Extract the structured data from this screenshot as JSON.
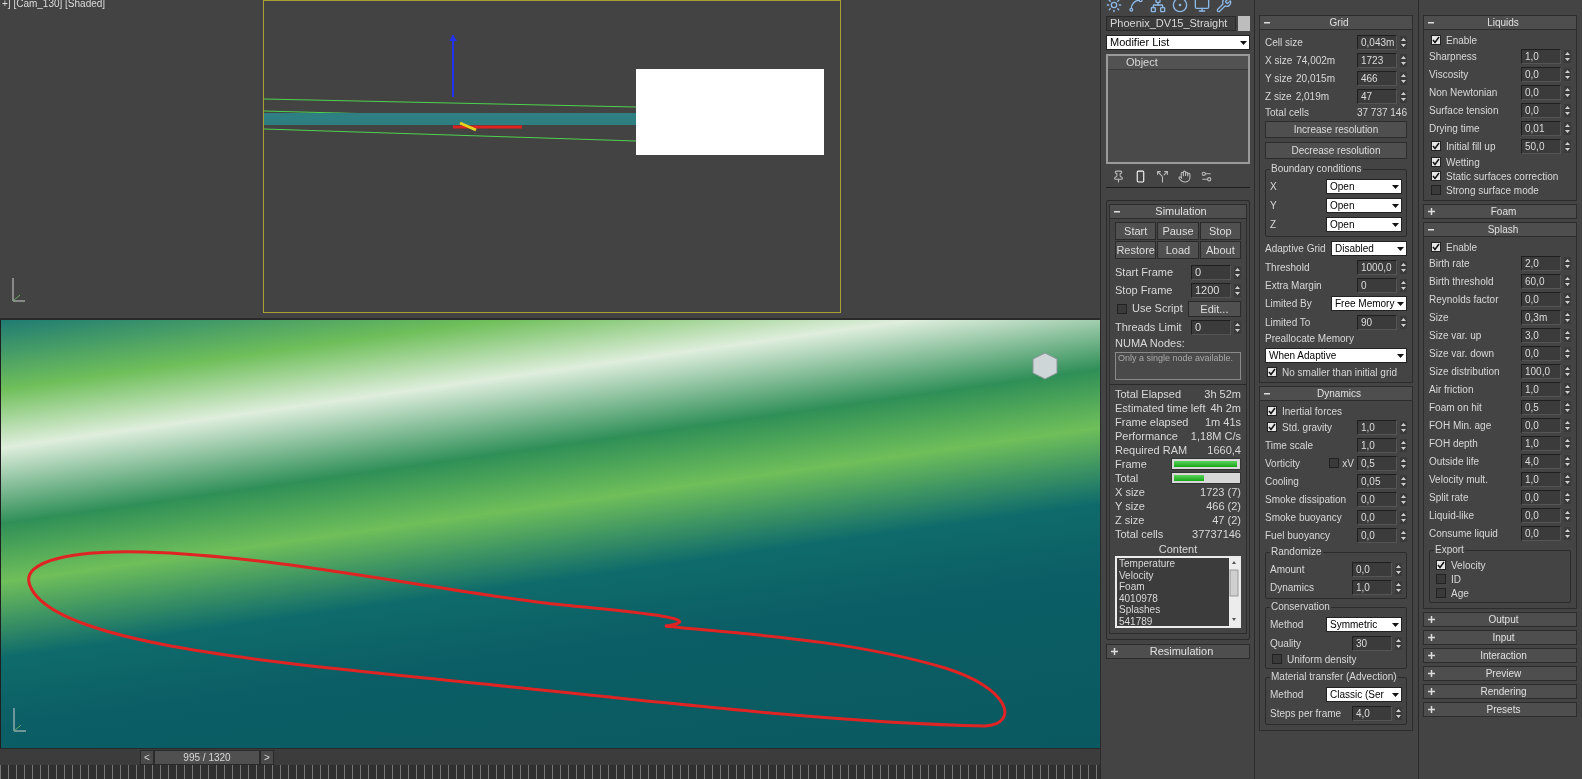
{
  "viewport": {
    "label": "+] [Cam_130] [Shaded]",
    "time_slider": {
      "prev": "<",
      "position": "995 / 1320",
      "next": ">"
    }
  },
  "modify_panel": {
    "object_name": "Phoenix_DV15_Straight",
    "modifier_list": "Modifier List",
    "stack_header": "Object",
    "rollouts": [
      {
        "title": "Simulation",
        "expanded": true,
        "rows": [
          {
            "kind": "button_grid",
            "buttons": [
              "Start",
              "Pause",
              "Stop",
              "Restore",
              "Load",
              "About"
            ]
          },
          {
            "kind": "spinner",
            "label": "Start Frame",
            "value": "0"
          },
          {
            "kind": "spinner",
            "label": "Stop Frame",
            "value": "1200"
          },
          {
            "kind": "check_button",
            "label": "Use Script",
            "checked": false,
            "button": "Edit..."
          },
          {
            "kind": "spinner",
            "label": "Threads Limit",
            "value": "0"
          },
          {
            "kind": "textarea",
            "label": "NUMA Nodes:",
            "placeholder": "Only a single node available."
          },
          {
            "kind": "stats",
            "rows": [
              {
                "kind": "stat",
                "label": "Total Elapsed",
                "value": "3h 52m"
              },
              {
                "kind": "stat",
                "label": "Estimated time left",
                "value": "4h 2m"
              },
              {
                "kind": "stat",
                "label": "Frame elapsed",
                "value": "1m 41s"
              },
              {
                "kind": "stat",
                "label": "Performance",
                "value": "1,18M C/s"
              },
              {
                "kind": "stat",
                "label": "Required RAM",
                "value": "1660,4"
              },
              {
                "kind": "progress",
                "label": "Frame",
                "level": 0.99
              },
              {
                "kind": "progress",
                "label": "Total",
                "level": 0.47
              },
              {
                "kind": "stat",
                "label": "X size",
                "value": "1723 (7)"
              },
              {
                "kind": "stat",
                "label": "Y size",
                "value": "466 (2)"
              },
              {
                "kind": "stat",
                "label": "Z size",
                "value": "47 (2)"
              },
              {
                "kind": "stat",
                "label": "Total cells",
                "value": "37737146"
              },
              {
                "kind": "list",
                "title": "Content",
                "lines": [
                  "Temperature",
                  "Velocity",
                  "Foam",
                  "4010978",
                  "Splashes",
                  "541789"
                ]
              }
            ]
          }
        ]
      },
      {
        "title": "Resimulation",
        "expanded": false
      }
    ]
  },
  "grid_panel": {
    "rollouts": [
      {
        "title": "Grid",
        "expanded": true,
        "rows": [
          {
            "kind": "spinner",
            "label": "Cell size",
            "value": "0,043m"
          },
          {
            "kind": "spinner",
            "label": "X size",
            "measure": "74,002m",
            "value": "1723"
          },
          {
            "kind": "spinner",
            "label": "Y size",
            "measure": "20,015m",
            "value": "466"
          },
          {
            "kind": "spinner",
            "label": "Z size",
            "measure": "2,019m",
            "value": "47"
          },
          {
            "kind": "stat",
            "label": "Total cells",
            "value": "37 737 146"
          },
          {
            "kind": "button",
            "label": "Increase resolution"
          },
          {
            "kind": "button",
            "label": "Decrease resolution"
          },
          {
            "kind": "group",
            "title": "Boundary conditions",
            "rows": [
              {
                "kind": "dropdown",
                "label": "X",
                "value": "Open"
              },
              {
                "kind": "dropdown",
                "label": "Y",
                "value": "Open"
              },
              {
                "kind": "dropdown",
                "label": "Z",
                "value": "Open"
              }
            ]
          },
          {
            "kind": "dropdown",
            "label": "Adaptive Grid",
            "value": "Disabled"
          },
          {
            "kind": "spinner",
            "label": "Threshold",
            "value": "1000,0"
          },
          {
            "kind": "spinner",
            "label": "Extra Margin",
            "value": "0"
          },
          {
            "kind": "dropdown",
            "label": "Limited By",
            "value": "Free Memory"
          },
          {
            "kind": "spinner",
            "label": "Limited To",
            "value": "90"
          },
          {
            "kind": "heading",
            "label": "Preallocate Memory"
          },
          {
            "kind": "dropdown",
            "value": "When Adaptive"
          },
          {
            "kind": "check",
            "label": "No smaller than initial grid",
            "checked": true
          }
        ]
      },
      {
        "title": "Dynamics",
        "expanded": true,
        "rows": [
          {
            "kind": "check",
            "label": "Inertial forces",
            "checked": true
          },
          {
            "kind": "check_spinner",
            "label": "Std. gravity",
            "checked": true,
            "value": "1,0"
          },
          {
            "kind": "spinner",
            "label": "Time scale",
            "value": "1,0"
          },
          {
            "kind": "check_inline_spinner",
            "label": "Vorticity",
            "checked": false,
            "check_label": "xV",
            "value": "0,5"
          },
          {
            "kind": "spinner",
            "label": "Cooling",
            "value": "0,05"
          },
          {
            "kind": "spinner",
            "label": "Smoke dissipation",
            "value": "0,0"
          },
          {
            "kind": "spinner",
            "label": "Smoke buoyancy",
            "value": "0,0"
          },
          {
            "kind": "spinner",
            "label": "Fuel buoyancy",
            "value": "0,0"
          },
          {
            "kind": "group",
            "title": "Randomize",
            "rows": [
              {
                "kind": "spinner",
                "label": "Amount",
                "value": "0,0"
              },
              {
                "kind": "spinner",
                "label": "Dynamics",
                "value": "1,0"
              }
            ]
          },
          {
            "kind": "group",
            "title": "Conservation",
            "rows": [
              {
                "kind": "dropdown",
                "label": "Method",
                "value": "Symmetric"
              },
              {
                "kind": "spinner",
                "label": "Quality",
                "value": "30"
              },
              {
                "kind": "check",
                "label": "Uniform density",
                "checked": false
              }
            ]
          },
          {
            "kind": "group",
            "title": "Material transfer (Advection)",
            "rows": [
              {
                "kind": "dropdown",
                "label": "Method",
                "value": "Classic (Ser"
              },
              {
                "kind": "spinner",
                "label": "Steps per frame",
                "value": "4,0"
              }
            ]
          }
        ]
      }
    ]
  },
  "liquid_panel": {
    "rollouts": [
      {
        "title": "Liquids",
        "expanded": true,
        "rows": [
          {
            "kind": "check",
            "label": "Enable",
            "checked": true
          },
          {
            "kind": "spinner",
            "label": "Sharpness",
            "value": "1,0"
          },
          {
            "kind": "spinner",
            "label": "Viscosity",
            "value": "0,0"
          },
          {
            "kind": "spinner",
            "label": "Non Newtonian",
            "value": "0,0"
          },
          {
            "kind": "spinner",
            "label": "Surface tension",
            "value": "0,0"
          },
          {
            "kind": "spinner",
            "label": "Drying time",
            "value": "0,01"
          },
          {
            "kind": "check_spinner",
            "label": "Initial fill up",
            "checked": true,
            "value": "50,0"
          },
          {
            "kind": "check",
            "label": "Wetting",
            "checked": true
          },
          {
            "kind": "check",
            "label": "Static surfaces correction",
            "checked": true
          },
          {
            "kind": "check",
            "label": "Strong surface mode",
            "checked": false
          }
        ]
      },
      {
        "title": "Foam",
        "expanded": false
      },
      {
        "title": "Splash",
        "expanded": true,
        "rows": [
          {
            "kind": "check",
            "label": "Enable",
            "checked": true
          },
          {
            "kind": "spinner",
            "label": "Birth rate",
            "value": "2,0"
          },
          {
            "kind": "spinner",
            "label": "Birth threshold",
            "value": "60,0"
          },
          {
            "kind": "spinner",
            "label": "Reynolds factor",
            "value": "0,0"
          },
          {
            "kind": "spinner",
            "label": "Size",
            "value": "0,3m"
          },
          {
            "kind": "spinner",
            "label": "Size var. up",
            "value": "3,0"
          },
          {
            "kind": "spinner",
            "label": "Size var. down",
            "value": "0,0"
          },
          {
            "kind": "spinner",
            "label": "Size distribution",
            "value": "100,0"
          },
          {
            "kind": "spinner",
            "label": "Air friction",
            "value": "1,0"
          },
          {
            "kind": "spinner",
            "label": "Foam on hit",
            "value": "0,5"
          },
          {
            "kind": "spinner",
            "label": "FOH Min. age",
            "value": "0,0"
          },
          {
            "kind": "spinner",
            "label": "FOH depth",
            "value": "1,0"
          },
          {
            "kind": "spinner",
            "label": "Outside life",
            "value": "4,0"
          },
          {
            "kind": "spinner",
            "label": "Velocity mult.",
            "value": "1,0"
          },
          {
            "kind": "spinner",
            "label": "Split rate",
            "value": "0,0"
          },
          {
            "kind": "spinner",
            "label": "Liquid-like",
            "value": "0,0"
          },
          {
            "kind": "spinner",
            "label": "Consume liquid",
            "value": "0,0"
          },
          {
            "kind": "group",
            "title": "Export",
            "rows": [
              {
                "kind": "check",
                "label": "Velocity",
                "checked": true
              },
              {
                "kind": "check",
                "label": "ID",
                "checked": false
              },
              {
                "kind": "check",
                "label": "Age",
                "checked": false
              }
            ]
          }
        ]
      },
      {
        "title": "Output",
        "expanded": false
      },
      {
        "title": "Input",
        "expanded": false
      },
      {
        "title": "Interaction",
        "expanded": false
      },
      {
        "title": "Preview",
        "expanded": false
      },
      {
        "title": "Rendering",
        "expanded": false
      },
      {
        "title": "Presets",
        "expanded": false
      }
    ]
  }
}
